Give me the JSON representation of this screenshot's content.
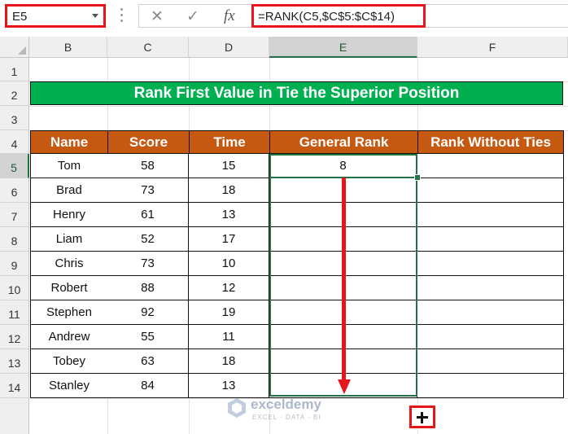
{
  "formula_bar": {
    "name_box": "E5",
    "formula": "=RANK(C5,$C$5:$C$14)",
    "cancel_glyph": "✕",
    "enter_glyph": "✓",
    "fx_glyph": "fx"
  },
  "columns": [
    "B",
    "C",
    "D",
    "E",
    "F"
  ],
  "rows": [
    "1",
    "2",
    "3",
    "4",
    "5",
    "6",
    "7",
    "8",
    "9",
    "10",
    "11",
    "12",
    "13",
    "14"
  ],
  "title": "Rank First Value in Tie the Superior Position",
  "table": {
    "headers": [
      "Name",
      "Score",
      "Time",
      "General Rank",
      "Rank Without Ties"
    ],
    "rows": [
      {
        "name": "Tom",
        "score": "58",
        "time": "15",
        "rank": "8",
        "unique": ""
      },
      {
        "name": "Brad",
        "score": "73",
        "time": "18",
        "rank": "",
        "unique": ""
      },
      {
        "name": "Henry",
        "score": "61",
        "time": "13",
        "rank": "",
        "unique": ""
      },
      {
        "name": "Liam",
        "score": "52",
        "time": "17",
        "rank": "",
        "unique": ""
      },
      {
        "name": "Chris",
        "score": "73",
        "time": "10",
        "rank": "",
        "unique": ""
      },
      {
        "name": "Robert",
        "score": "88",
        "time": "12",
        "rank": "",
        "unique": ""
      },
      {
        "name": "Stephen",
        "score": "92",
        "time": "19",
        "rank": "",
        "unique": ""
      },
      {
        "name": "Andrew",
        "score": "55",
        "time": "11",
        "rank": "",
        "unique": ""
      },
      {
        "name": "Tobey",
        "score": "63",
        "time": "18",
        "rank": "",
        "unique": ""
      },
      {
        "name": "Stanley",
        "score": "84",
        "time": "13",
        "rank": "",
        "unique": ""
      }
    ]
  },
  "watermark": {
    "name": "exceldemy",
    "tagline": "EXCEL · DATA · BI"
  },
  "colors": {
    "title_fill": "#00b050",
    "header_fill": "#c65911",
    "highlight_red": "#e8161c",
    "selection_green": "#217346"
  },
  "icons": [
    "dropdown-icon",
    "cancel-icon",
    "enter-icon",
    "fx-icon",
    "fill-handle-plus-icon",
    "exceldemy-logo-icon"
  ]
}
